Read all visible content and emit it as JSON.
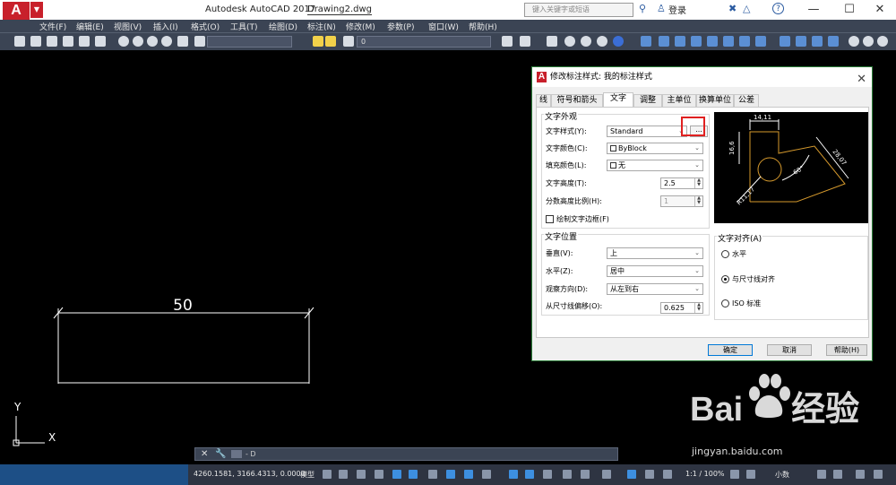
{
  "titlebar": {
    "app_title": "Autodesk AutoCAD 2017",
    "file_name": "Drawing2.dwg",
    "search_placeholder": "键入关键字或短语",
    "login_label": "登录",
    "logo_letter": "A",
    "logo_dropdown": "▼",
    "user_glyph": "♙",
    "x_glyph": "✖",
    "help_glyph": "?",
    "minimize": "—",
    "maximize": "☐",
    "close": "✕"
  },
  "menubar": [
    "文件(F)",
    "编辑(E)",
    "视图(V)",
    "插入(I)",
    "格式(O)",
    "工具(T)",
    "绘图(D)",
    "标注(N)",
    "修改(M)",
    "参数(P)",
    "窗口(W)",
    "帮助(H)"
  ],
  "toolbar": {
    "layer_value": "0"
  },
  "canvas": {
    "dimension_text": "50",
    "ucs_x": "X",
    "ucs_y": "Y"
  },
  "dialog": {
    "title": "修改标注样式: 我的标注样式",
    "logo_letter": "A",
    "close": "✕",
    "tabs": [
      "线",
      "符号和箭头",
      "文字",
      "调整",
      "主单位",
      "换算单位",
      "公差"
    ],
    "active_tab": "文字",
    "text_appearance": {
      "group_label": "文字外观",
      "style_label": "文字样式(Y):",
      "style_value": "Standard",
      "more_button": "...",
      "color_label": "文字颜色(C):",
      "color_value": "ByBlock",
      "fill_label": "填充颜色(L):",
      "fill_value": "无",
      "height_label": "文字高度(T):",
      "height_value": "2.5",
      "fraction_label": "分数高度比例(H):",
      "fraction_value": "1",
      "frame_label": "绘制文字边框(F)"
    },
    "text_placement": {
      "group_label": "文字位置",
      "vertical_label": "垂直(V):",
      "vertical_value": "上",
      "horizontal_label": "水平(Z):",
      "horizontal_value": "居中",
      "view_label": "观察方向(D):",
      "view_value": "从左到右",
      "offset_label": "从尺寸线偏移(O):",
      "offset_value": "0.625"
    },
    "text_alignment": {
      "group_label": "文字对齐(A)",
      "options": [
        "水平",
        "与尺寸线对齐",
        "ISO 标准"
      ],
      "selected": 1
    },
    "preview": {
      "dim_top": "14,11",
      "dim_left": "16,6",
      "dim_right": "28,07",
      "dim_angle": "60°",
      "dim_radius": "R11,17"
    },
    "buttons": {
      "ok": "确定",
      "cancel": "取消",
      "help": "帮助(H)"
    }
  },
  "command_line": {
    "text": "- D"
  },
  "statusbar": {
    "coordinates": "4260.1581, 3166.4313, 0.0000",
    "model_label": "模型",
    "scale": "1:1 / 100%",
    "units": "小数"
  },
  "watermark": {
    "brand": "Bai",
    "brand_cn": "经验",
    "url": "jingyan.baidu.com"
  }
}
